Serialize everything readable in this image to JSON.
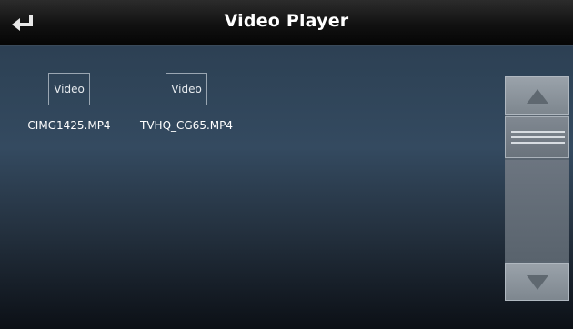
{
  "header": {
    "back_icon": "return-arrow-icon",
    "title": "Video Player"
  },
  "files": [
    {
      "thumb_label": "Video",
      "name": "CIMG1425.MP4"
    },
    {
      "thumb_label": "Video",
      "name": "TVHQ_CG65.MP4"
    }
  ],
  "scrollbar": {
    "up_icon": "triangle-up-icon",
    "down_icon": "triangle-down-icon",
    "thumb_icon": "grip-lines-icon"
  },
  "colors": {
    "title_text": "#ffffff",
    "scroll_button": "#8a929a",
    "scroll_track": "#5a6570",
    "background_top": "#2a3b4e",
    "background_bottom": "#0c1016"
  }
}
